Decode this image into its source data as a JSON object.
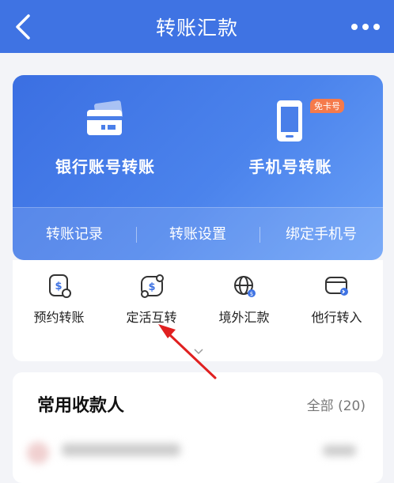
{
  "header": {
    "title": "转账汇款"
  },
  "main_features": [
    {
      "label": "银行账号转账",
      "icon": "bank-card-icon"
    },
    {
      "label": "手机号转账",
      "icon": "phone-icon",
      "badge": "免卡号"
    }
  ],
  "sub_links": [
    "转账记录",
    "转账设置",
    "绑定手机号"
  ],
  "quick_actions": [
    {
      "label": "预约转账",
      "icon": "scheduled-transfer-icon"
    },
    {
      "label": "定活互转",
      "icon": "fixed-demand-transfer-icon"
    },
    {
      "label": "境外汇款",
      "icon": "overseas-remittance-icon"
    },
    {
      "label": "他行转入",
      "icon": "other-bank-transfer-in-icon"
    }
  ],
  "recipients": {
    "title": "常用收款人",
    "all_label": "全部 (20)"
  },
  "colors": {
    "primary": "#3f73e3",
    "badge": "#f57a4b",
    "annotation": "#e02020"
  }
}
